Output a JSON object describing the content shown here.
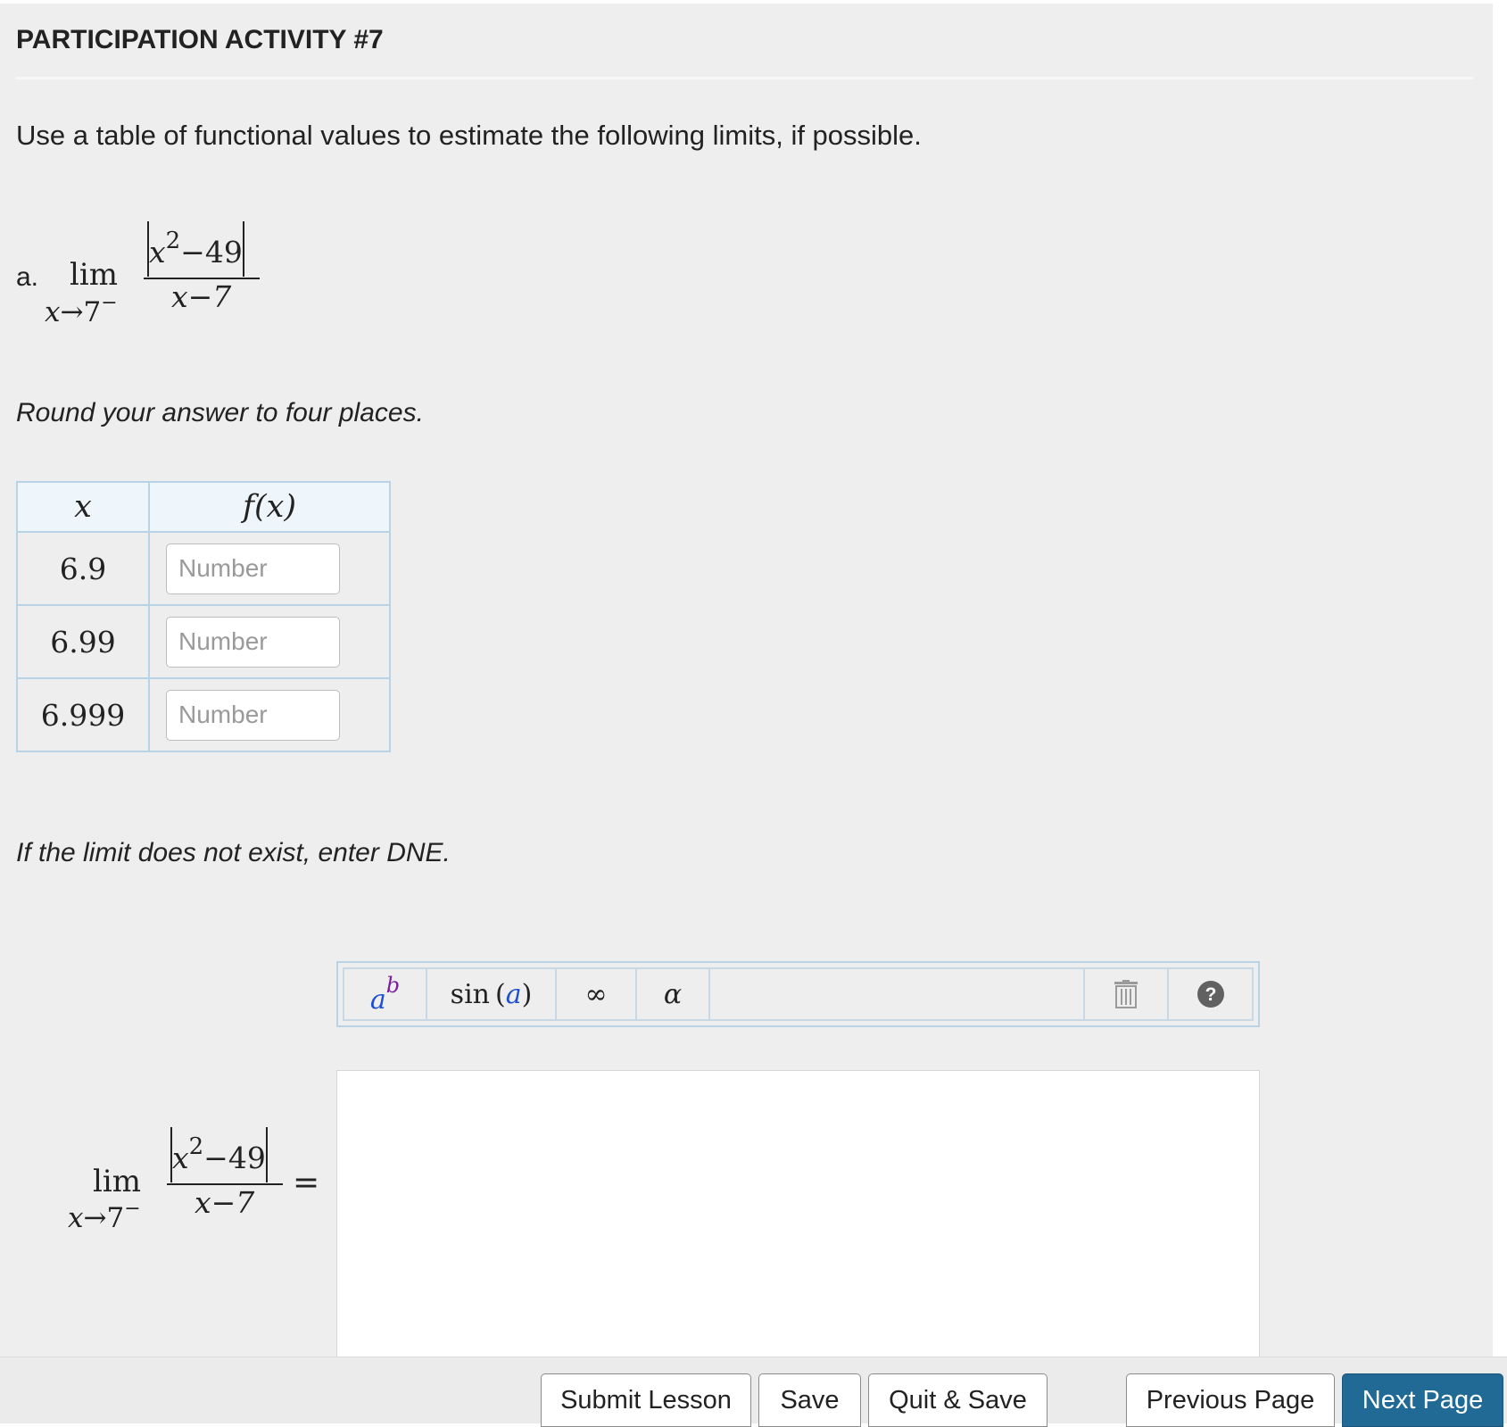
{
  "header": {
    "title": "PARTICIPATION ACTIVITY #7"
  },
  "instructions": "Use a table of functional values to estimate the following limits, if possible.",
  "part": {
    "label": "a.",
    "lim_word": "lim",
    "approach_var": "x",
    "approach_arrow": "→",
    "approach_value": "7",
    "approach_side": "−",
    "numerator_var": "x",
    "numerator_exp": "2",
    "numerator_rest": "−49",
    "denominator": "x−7"
  },
  "round_note": "Round your answer to four places.",
  "table": {
    "headers": {
      "x": "x",
      "fx": "f(x)"
    },
    "rows": [
      {
        "x": "6.9",
        "placeholder": "Number"
      },
      {
        "x": "6.99",
        "placeholder": "Number"
      },
      {
        "x": "6.999",
        "placeholder": "Number"
      }
    ]
  },
  "dne_note": "If the limit does not exist, enter DNE.",
  "toolbar": {
    "power_base": "a",
    "power_exp": "b",
    "sin_label": "sin",
    "sin_arg": "a",
    "infinity": "∞",
    "alpha": "α",
    "help": "?"
  },
  "answer": {
    "equals": "="
  },
  "colors": {
    "accent": "#216a96",
    "table_border": "#b9d3e6",
    "power_base": "#1d4fd1",
    "power_exp": "#7a1fa2"
  },
  "footer": {
    "submit": "Submit Lesson",
    "save": "Save",
    "quit_save": "Quit & Save",
    "previous": "Previous Page",
    "next": "Next Page"
  }
}
